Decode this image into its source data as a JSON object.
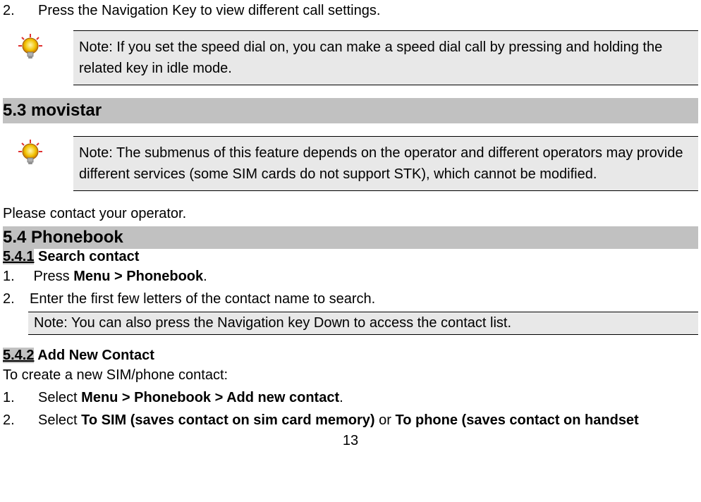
{
  "intro_item": {
    "num": "2.",
    "text": "Press the Navigation Key to view different call settings."
  },
  "note1": {
    "text": "Note: If you set the speed dial on, you can make a speed dial call by pressing and holding the related key in idle mode."
  },
  "section53": {
    "heading": "5.3 movistar"
  },
  "note2": {
    "text": "Note: The submenus of this feature depends on the operator and different operators may provide different services (some SIM cards do not support STK), which cannot be modified."
  },
  "contact_operator": "Please contact your operator.",
  "section54": {
    "heading": "5.4 Phonebook",
    "sub1_number": "5.4.1",
    "sub1_title": " Search contact",
    "sub1_item1_num": "1.",
    "sub1_item1_prefix": " Press ",
    "sub1_item1_bold": "Menu > Phonebook",
    "sub1_item1_suffix": ".",
    "sub1_item2_num": "2.",
    "sub1_item2_text": "Enter the first few letters of the contact name to search.",
    "note3": "Note: You can also press the Navigation key Down to access the contact list.",
    "sub2_number": "5.4.2",
    "sub2_title": " Add New Contact",
    "sub2_intro": "To create a new SIM/phone contact:",
    "sub2_item1_num": "1.",
    "sub2_item1_prefix": "Select ",
    "sub2_item1_bold": "Menu > Phonebook > Add new contact",
    "sub2_item1_suffix": ".",
    "sub2_item2_num": "2.",
    "sub2_item2_prefix": "Select ",
    "sub2_item2_bold1": "To SIM (saves contact on sim card memory) ",
    "sub2_item2_mid": "or ",
    "sub2_item2_bold2": "To phone (saves contact on handset"
  },
  "page_number": "13"
}
